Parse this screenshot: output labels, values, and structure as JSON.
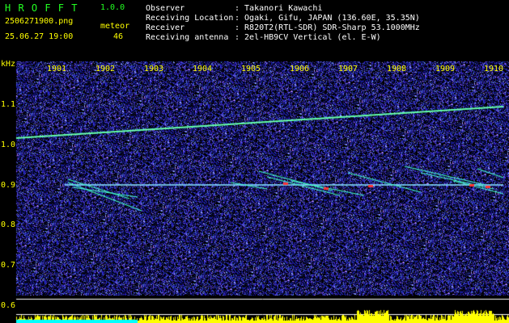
{
  "app": {
    "name": "H R O F F T",
    "version": "1.0.0"
  },
  "file": {
    "name": "2506271900.png",
    "datetime": "25.06.27 19:00"
  },
  "meteor": {
    "label": "meteor",
    "count": "46"
  },
  "info": [
    {
      "label": "Observer",
      "value": ": Takanori Kawachi"
    },
    {
      "label": "Receiving Location",
      "value": ": Ogaki, Gifu, JAPAN (136.60E, 35.35N)"
    },
    {
      "label": "Receiver",
      "value": ": R820T2(RTL-SDR) SDR-Sharp 53.1000MHz"
    },
    {
      "label": "Receiving antenna",
      "value": ": 2el-HB9CV Vertical (el. E-W)"
    }
  ],
  "axes": {
    "unit": "kHz",
    "x_ticks": [
      "1901",
      "1902",
      "1903",
      "1904",
      "1905",
      "1906",
      "1907",
      "1908",
      "1909",
      "1910"
    ],
    "y_ticks": [
      "1.1",
      "1.0",
      "0.9",
      "0.8",
      "0.7",
      "0.6"
    ]
  },
  "colors": {
    "background": "#000000",
    "noise": "#1a1a8c",
    "carrier": "#33ff99",
    "label": "#ffff00",
    "meteor": "#ff3333"
  }
}
